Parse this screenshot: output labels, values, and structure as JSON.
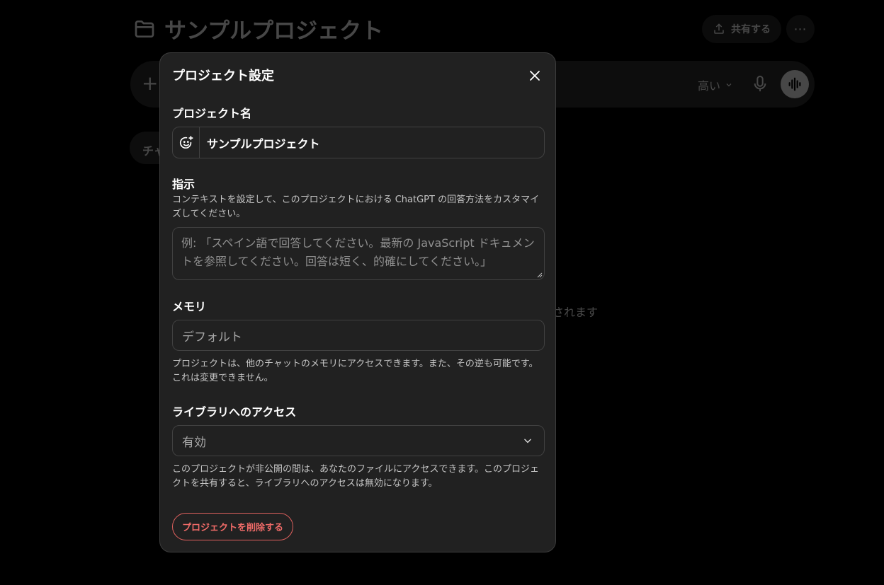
{
  "background": {
    "project_title": "サンプルプロジェクト",
    "share_label": "共有する",
    "more_label": "⋯",
    "plus_label": "+",
    "effort_label": "高い",
    "chip_label": "チャ",
    "fragment_text": "されます"
  },
  "modal": {
    "title": "プロジェクト設定",
    "name_label": "プロジェクト名",
    "name_value": "サンプルプロジェクト",
    "instructions_label": "指示",
    "instructions_desc": "コンテキストを設定して、このプロジェクトにおける ChatGPT の回答方法をカスタマイズしてください。",
    "instructions_placeholder": "例: 「スペイン語で回答してください。最新の JavaScript ドキュメントを参照してください。回答は短く、的確にしてください。」",
    "memory_label": "メモリ",
    "memory_value": "デフォルト",
    "memory_desc": "プロジェクトは、他のチャットのメモリにアクセスできます。また、その逆も可能です。これは変更できません。",
    "library_label": "ライブラリへのアクセス",
    "library_value": "有効",
    "library_desc": "このプロジェクトが非公開の間は、あなたのファイルにアクセスできます。このプロジェクトを共有すると、ライブラリへのアクセスは無効になります。",
    "delete_label": "プロジェクトを削除する"
  },
  "colors": {
    "background": "#000000",
    "modal_bg": "#212121",
    "field_border": "#414141",
    "danger": "#f06b68"
  }
}
